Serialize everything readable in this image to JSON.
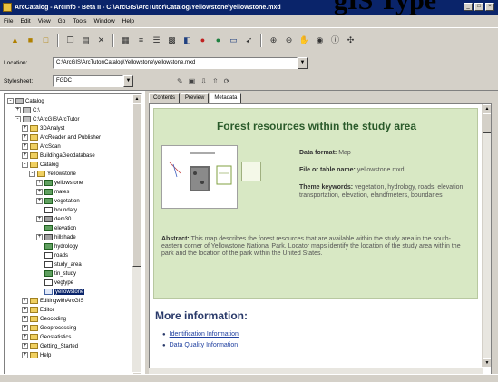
{
  "window": {
    "title": "ArcCatalog - ArcInfo - Beta II - C:\\ArcGIS\\ArcTutor\\Catalog\\Yellowstone\\yellowstone.mxd",
    "overlay_text": "gIS Type",
    "controls": [
      "_",
      "□",
      "×"
    ]
  },
  "menu": [
    "File",
    "Edit",
    "View",
    "Go",
    "Tools",
    "Window",
    "Help"
  ],
  "toolbar_icons": [
    "up-folder-icon",
    "connect-folder-icon",
    "disconnect-folder-icon",
    "copy-icon",
    "paste-icon",
    "delete-icon",
    "large-icons-icon",
    "list-icon",
    "details-icon",
    "thumbnails-icon",
    "catalog-tree-icon",
    "arctoolbox-icon",
    "metadata-icon",
    "search-icon",
    "zoom-in-icon",
    "zoom-out-icon",
    "pan-icon",
    "full-extent-icon",
    "identify-icon",
    "create-thumbnail-icon"
  ],
  "location": {
    "label": "Location:",
    "value": "C:\\ArcGIS\\ArcTutor\\Catalog\\Yellowstone\\yellowstone.mxd"
  },
  "stylesheet": {
    "label": "Stylesheet:",
    "value": "FGDC"
  },
  "tree": [
    {
      "label": "Catalog",
      "depth": 0,
      "icon": "catalog",
      "exp": "-"
    },
    {
      "label": "C:\\",
      "depth": 1,
      "icon": "drive",
      "exp": "+"
    },
    {
      "label": "C:\\ArcGIS\\ArcTutor",
      "depth": 1,
      "icon": "drive",
      "exp": "-"
    },
    {
      "label": "3DAnalyst",
      "depth": 2,
      "icon": "folder",
      "exp": "+"
    },
    {
      "label": "ArcReader and Publisher",
      "depth": 2,
      "icon": "folder",
      "exp": "+"
    },
    {
      "label": "ArcScan",
      "depth": 2,
      "icon": "folder",
      "exp": "+"
    },
    {
      "label": "BuildingaGeodatabase",
      "depth": 2,
      "icon": "folder",
      "exp": "+"
    },
    {
      "label": "Catalog",
      "depth": 2,
      "icon": "folder",
      "exp": "-"
    },
    {
      "label": "Yellowstone",
      "depth": 3,
      "icon": "folder",
      "exp": "-"
    },
    {
      "label": "yellowstone",
      "depth": 4,
      "icon": "layer",
      "exp": "+"
    },
    {
      "label": "mates",
      "depth": 4,
      "icon": "layer",
      "exp": "+"
    },
    {
      "label": "vegetation",
      "depth": 4,
      "icon": "layer",
      "exp": "+"
    },
    {
      "label": "boundary",
      "depth": 4,
      "icon": "tbl",
      "exp": ""
    },
    {
      "label": "dem30",
      "depth": 4,
      "icon": "grid",
      "exp": "+"
    },
    {
      "label": "elevation",
      "depth": 4,
      "icon": "layer",
      "exp": ""
    },
    {
      "label": "hillshade",
      "depth": 4,
      "icon": "grid",
      "exp": "+"
    },
    {
      "label": "hydrology",
      "depth": 4,
      "icon": "layer",
      "exp": ""
    },
    {
      "label": "roads",
      "depth": 4,
      "icon": "tbl",
      "exp": ""
    },
    {
      "label": "study_area",
      "depth": 4,
      "icon": "tbl",
      "exp": ""
    },
    {
      "label": "tin_study",
      "depth": 4,
      "icon": "layer",
      "exp": ""
    },
    {
      "label": "vegtype",
      "depth": 4,
      "icon": "tbl",
      "exp": ""
    },
    {
      "label": "yellowstone",
      "depth": 4,
      "icon": "map",
      "exp": "",
      "selected": true
    },
    {
      "label": "EditingwithArcGIS",
      "depth": 2,
      "icon": "folder",
      "exp": "+"
    },
    {
      "label": "Editor",
      "depth": 2,
      "icon": "folder",
      "exp": "+"
    },
    {
      "label": "Geocoding",
      "depth": 2,
      "icon": "folder",
      "exp": "+"
    },
    {
      "label": "Geoprocessing",
      "depth": 2,
      "icon": "folder",
      "exp": "+"
    },
    {
      "label": "Geostatistics",
      "depth": 2,
      "icon": "folder",
      "exp": "+"
    },
    {
      "label": "Getting_Started",
      "depth": 2,
      "icon": "folder",
      "exp": "+"
    },
    {
      "label": "Help",
      "depth": 2,
      "icon": "folder",
      "exp": "+"
    }
  ],
  "tabs": [
    "Contents",
    "Preview",
    "Metadata"
  ],
  "active_tab": "Metadata",
  "metadata": {
    "title": "Forest resources within the study area",
    "data_format_label": "Data format:",
    "data_format_value": "Map",
    "file_name_label": "File or table name:",
    "file_name_value": "yellowstone.mxd",
    "keywords_label": "Theme keywords:",
    "keywords_value": "vegetation, hydrology, roads, elevation, transportation, elevation, elandfmeters, boundaries",
    "abstract_label": "Abstract:",
    "abstract_value": "This map describes the forest resources that are available within the study area in the south-eastern corner of Yellowstone National Park. Locator maps identify the location of the study area within the park and the location of the park within the United States.",
    "more_info_title": "More information:",
    "links": [
      "Identification Information",
      "Data Quality Information"
    ]
  },
  "colors": {
    "titlebar": "#0a246a",
    "panel": "#d4d0c8",
    "metadata_box": "#d8e8c4",
    "metadata_title": "#2a5a2a",
    "link": "#2040a0"
  }
}
